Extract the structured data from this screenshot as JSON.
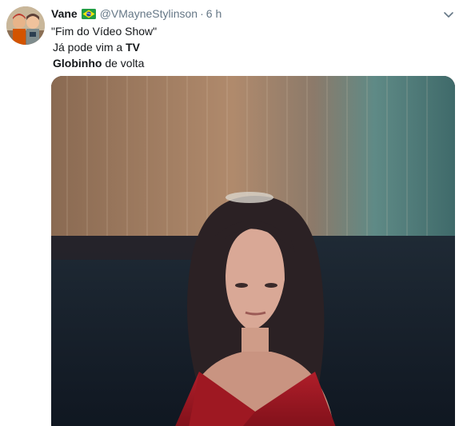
{
  "tweet": {
    "display_name": "Vane",
    "flag_emoji": "brazil-flag",
    "handle": "@VMayneStylinson",
    "separator": "·",
    "timestamp": "6 h",
    "caret_icon": "chevron-down-icon",
    "text": {
      "line1": "\"Fim do Vídeo Show\"",
      "line2_prefix": "Já pode vim a ",
      "line2_bold": "TV",
      "line3_bold": "Globinho",
      "line3_suffix": " de volta"
    }
  },
  "colors": {
    "secondary_text": "#657786",
    "primary_text": "#14171a",
    "background": "#ffffff"
  }
}
